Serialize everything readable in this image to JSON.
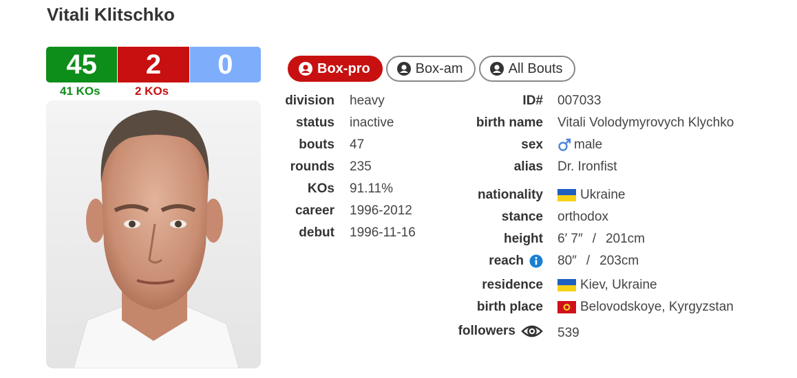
{
  "boxer": {
    "name": "Vitali Klitschko"
  },
  "record": {
    "wins": "45",
    "losses": "2",
    "draws": "0",
    "win_kos": "41 KOs",
    "loss_kos": "2 KOs"
  },
  "colors": {
    "win": "#0d8d1a",
    "loss": "#c81010",
    "draw": "#7eaefb",
    "sex_icon": "#4f86d9",
    "info_icon": "#1a7fd4"
  },
  "tabs": [
    {
      "label": "Box-pro",
      "active": true,
      "icon": "user-circle-icon"
    },
    {
      "label": "Box-am",
      "active": false,
      "icon": "user-circle-icon"
    },
    {
      "label": "All Bouts",
      "active": false,
      "icon": "user-circle-icon"
    }
  ],
  "left_stats": [
    {
      "label": "division",
      "value": "heavy"
    },
    {
      "label": "status",
      "value": "inactive"
    },
    {
      "label": "bouts",
      "value": "47"
    },
    {
      "label": "rounds",
      "value": "235"
    },
    {
      "label": "KOs",
      "value": "91.11%"
    },
    {
      "label": "career",
      "value": "1996-2012"
    },
    {
      "label": "debut",
      "value": "1996-11-16"
    }
  ],
  "right_stats": {
    "id": {
      "label": "ID#",
      "value": "007033"
    },
    "birth_name": {
      "label": "birth name",
      "value": "Vitali Volodymyrovych Klychko"
    },
    "sex": {
      "label": "sex",
      "value": "male",
      "icon": "male-symbol-icon"
    },
    "alias": {
      "label": "alias",
      "value": "Dr. Ironfist"
    },
    "nationality": {
      "label": "nationality",
      "value": "Ukraine",
      "flag": "ukraine-flag-icon"
    },
    "stance": {
      "label": "stance",
      "value": "orthodox"
    },
    "height": {
      "label": "height",
      "imperial": "6′ 7″",
      "separator": "/",
      "metric": "201cm"
    },
    "reach": {
      "label": "reach",
      "imperial": "80″",
      "separator": "/",
      "metric": "203cm",
      "icon": "info-icon"
    },
    "residence": {
      "label": "residence",
      "value": "Kiev, Ukraine",
      "flag": "ukraine-flag-icon"
    },
    "birth_place": {
      "label": "birth place",
      "value": "Belovodskoye, Kyrgyzstan",
      "flag": "kyrgyzstan-flag-icon"
    },
    "followers": {
      "label": "followers",
      "value": "539",
      "icon": "eye-icon"
    }
  }
}
